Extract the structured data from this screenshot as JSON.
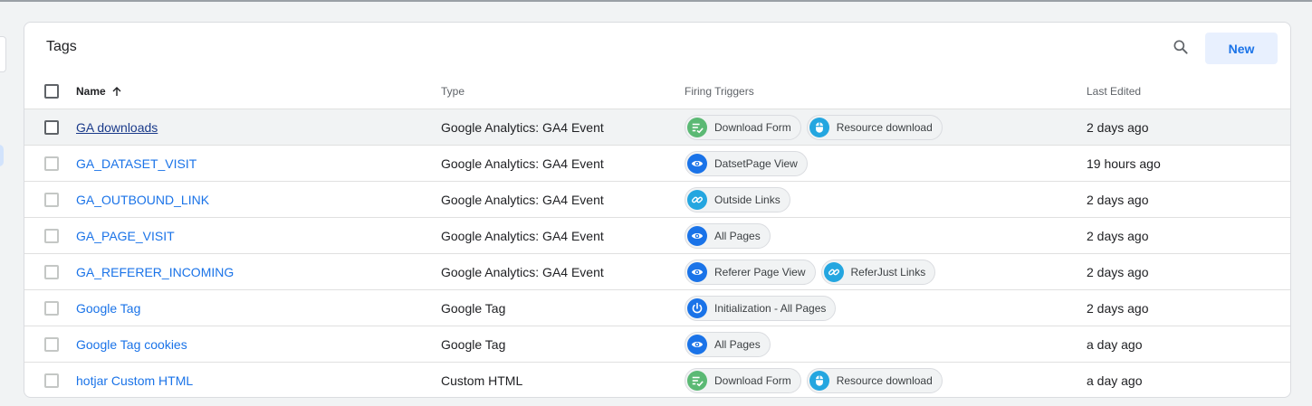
{
  "panel": {
    "title": "Tags",
    "new_label": "New"
  },
  "columns": {
    "name": "Name",
    "name_sort_icon": "arrow-up-icon",
    "type": "Type",
    "firing_triggers": "Firing Triggers",
    "last_edited": "Last Edited"
  },
  "trigger_colors": {
    "form": "#5bb974",
    "click": "#24a6e0",
    "pageview": "#1a73e8",
    "link": "#24a6e0",
    "init": "#1a73e8"
  },
  "rows": [
    {
      "name": "GA downloads",
      "type": "Google Analytics: GA4 Event",
      "triggers": [
        {
          "label": "Download Form",
          "icon": "form-submit-icon"
        },
        {
          "label": "Resource download",
          "icon": "mouse-click-icon"
        }
      ],
      "last_edited": "2 days ago"
    },
    {
      "name": "GA_DATASET_VISIT",
      "type": "Google Analytics: GA4 Event",
      "triggers": [
        {
          "label": "DatsetPage View",
          "icon": "eye-icon"
        }
      ],
      "last_edited": "19 hours ago"
    },
    {
      "name": "GA_OUTBOUND_LINK",
      "type": "Google Analytics: GA4 Event",
      "triggers": [
        {
          "label": "Outside Links",
          "icon": "link-icon"
        }
      ],
      "last_edited": "2 days ago"
    },
    {
      "name": "GA_PAGE_VISIT",
      "type": "Google Analytics: GA4 Event",
      "triggers": [
        {
          "label": "All Pages",
          "icon": "eye-icon"
        }
      ],
      "last_edited": "2 days ago"
    },
    {
      "name": "GA_REFERER_INCOMING",
      "type": "Google Analytics: GA4 Event",
      "triggers": [
        {
          "label": "Referer Page View",
          "icon": "eye-icon"
        },
        {
          "label": "ReferJust Links",
          "icon": "link-icon"
        }
      ],
      "last_edited": "2 days ago"
    },
    {
      "name": "Google Tag",
      "type": "Google Tag",
      "triggers": [
        {
          "label": "Initialization - All Pages",
          "icon": "power-icon"
        }
      ],
      "last_edited": "2 days ago"
    },
    {
      "name": "Google Tag cookies",
      "type": "Google Tag",
      "triggers": [
        {
          "label": "All Pages",
          "icon": "eye-icon"
        }
      ],
      "last_edited": "a day ago"
    },
    {
      "name": "hotjar Custom HTML",
      "type": "Custom HTML",
      "triggers": [
        {
          "label": "Download Form",
          "icon": "form-submit-icon"
        },
        {
          "label": "Resource download",
          "icon": "mouse-click-icon"
        }
      ],
      "last_edited": "a day ago"
    }
  ]
}
